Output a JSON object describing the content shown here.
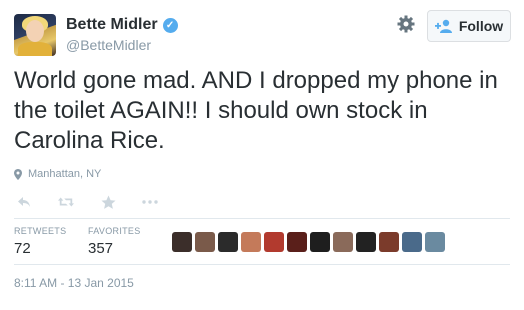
{
  "user": {
    "name": "Bette Midler",
    "handle": "@BetteMidler"
  },
  "follow_label": "Follow",
  "tweet": {
    "text": "World gone mad.  AND I dropped my phone in the toilet AGAIN!!  I should own stock in Carolina Rice.",
    "location": "Manhattan, NY",
    "timestamp": "8:11 AM - 13 Jan 2015"
  },
  "stats": {
    "retweets_label": "RETWEETS",
    "retweets": "72",
    "favorites_label": "FAVORITES",
    "favorites": "357"
  },
  "colors": {
    "verified": "#55acee",
    "muted": "#8899a6",
    "text": "#292f33"
  },
  "icons": [
    "gear-icon",
    "add-user-icon",
    "map-pin-icon",
    "reply-icon",
    "retweet-icon",
    "favorite-icon",
    "more-icon",
    "verified-icon"
  ],
  "favoriters": [
    "#3b2e2a",
    "#7a5a4a",
    "#2b2b2b",
    "#c47a5a",
    "#b23a2e",
    "#5a1f1a",
    "#1e1e1e",
    "#8a6a5a",
    "#222222",
    "#7b3b2b",
    "#4a6a8a",
    "#6a8aa0"
  ]
}
